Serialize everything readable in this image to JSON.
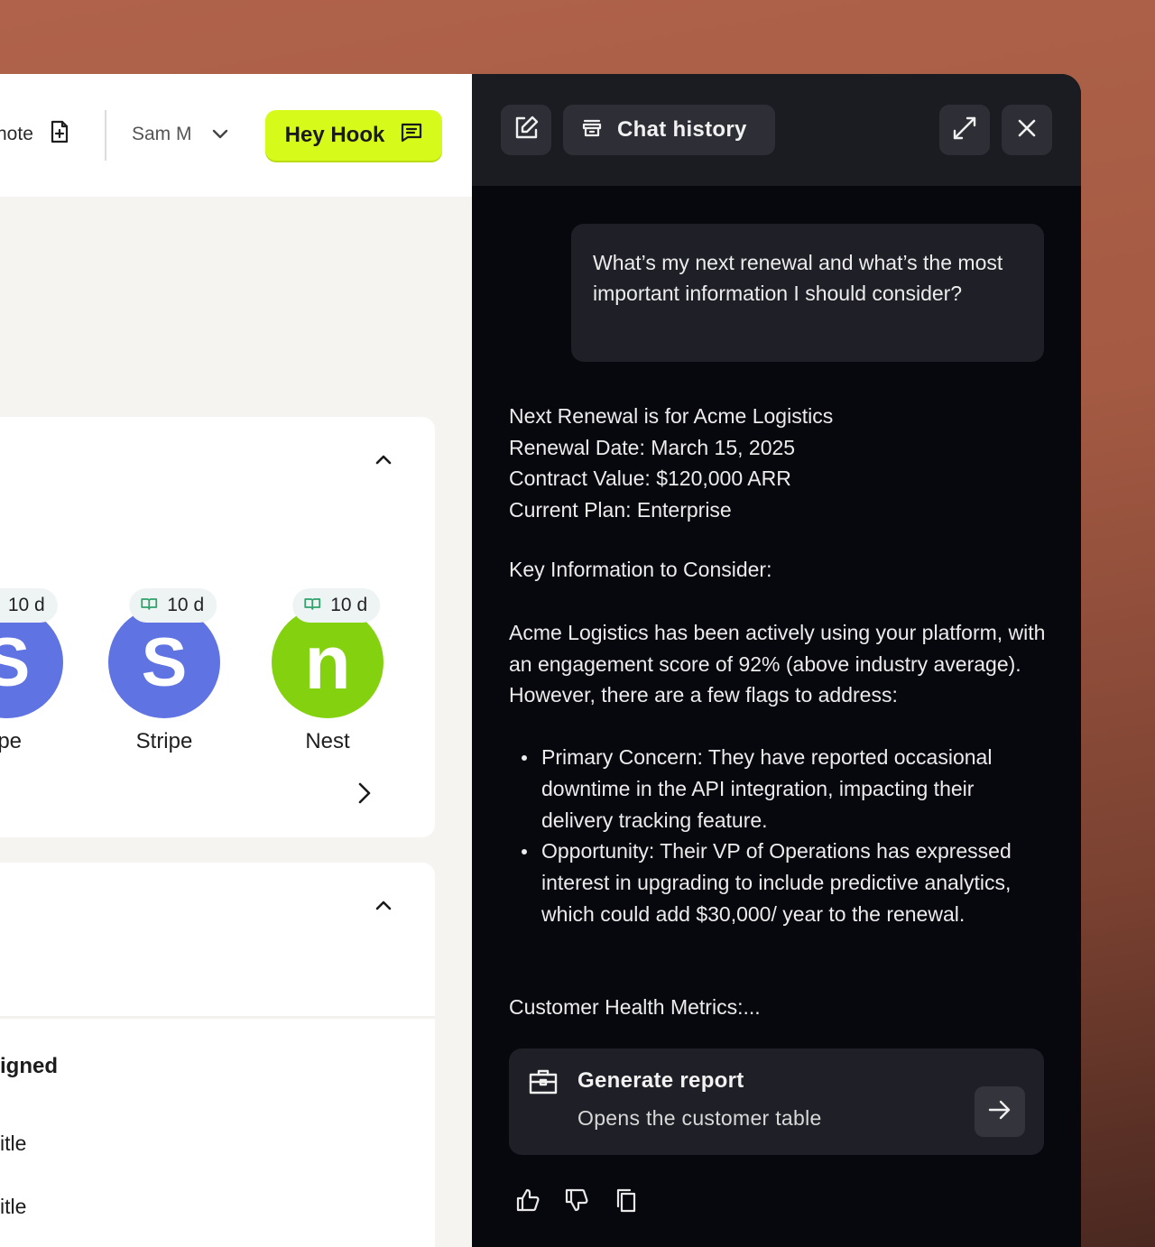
{
  "topbar": {
    "note_label": "note",
    "user_name": "Sam M",
    "hook_label": "Hey Hook"
  },
  "logos": [
    {
      "name": "ipe",
      "badge": "10 d",
      "color": "#5f73e3",
      "letter": "S"
    },
    {
      "name": "Stripe",
      "badge": "10 d",
      "color": "#5f73e3",
      "letter": "S"
    },
    {
      "name": "Nest",
      "badge": "10 d",
      "color": "#84d20f",
      "letter": "n"
    }
  ],
  "card2": {
    "assigned": "igned",
    "rows": [
      "itle",
      "itle"
    ]
  },
  "chat": {
    "history_label": "Chat history",
    "user_message": "What’s my next renewal and what’s the most important information I should consider?",
    "answer_lines": [
      "Next Renewal is for Acme Logistics",
      "Renewal Date: March 15, 2025",
      "Contract Value: $120,000 ARR",
      "Current Plan: Enterprise"
    ],
    "key_heading": "Key Information to Consider:",
    "paragraph": "Acme Logistics has been actively using your platform, with an engagement score of 92% (above industry average). However, there are a few flags to address:",
    "bullets": [
      "Primary Concern: They have reported occasional downtime in the API integration, impacting their delivery tracking feature.",
      "Opportunity: Their VP of Operations has expressed interest in upgrading to include predictive analytics, which could add $30,000/ year to the renewal."
    ],
    "metrics": "Customer Health Metrics:...",
    "report": {
      "title": "Generate report",
      "subtitle": "Opens the customer table"
    }
  },
  "icons": [
    "note-add-icon",
    "chevron-down-icon",
    "chat-icon",
    "edit-icon",
    "history-icon",
    "expand-icon",
    "close-icon",
    "chevron-up-icon",
    "chevron-right-icon",
    "briefcase-icon",
    "arrow-right-icon",
    "thumbs-up-icon",
    "thumbs-down-icon",
    "copy-icon",
    "book-icon",
    "home-icon"
  ],
  "colors": {
    "accent": "#d6fb1a",
    "chat_bg": "#07070e",
    "chat_header": "#1b1c22",
    "bubble": "#1f2027"
  }
}
